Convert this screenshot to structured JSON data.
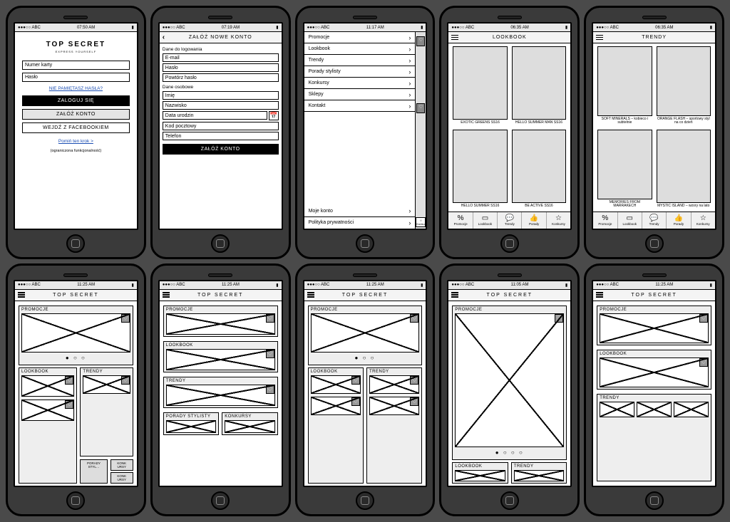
{
  "status": {
    "carrier": "●●●○○ ABC",
    "time1": "07:50 AM",
    "time2": "07:19 AM",
    "time3": "11:17 AM",
    "time4": "06:35 AM",
    "time5": "11:25 AM",
    "time6": "11:05 AM"
  },
  "login": {
    "logo": "TOP SECRET",
    "tagline": "EXPRESS YOURSELF",
    "card_placeholder": "Numer karty",
    "pass_placeholder": "Hasło",
    "forgot": "NIE PAMIĘTASZ HASŁA?",
    "btn_login": "ZALOGUJ SIĘ",
    "btn_register": "ZAŁÓŻ KONTO",
    "btn_fb": "WEJDŹ Z FACEBOOKIEM",
    "skip": "Pomiń ten krok >",
    "note": "(ograniczona funkcjonalność)"
  },
  "register": {
    "title": "ZAŁÓŻ NOWE KONTO",
    "sec1": "Dane do logowania",
    "email": "E-mail",
    "pass": "Hasło",
    "pass2": "Powtórz hasło",
    "sec2": "Dane osobowe",
    "fname": "Imię",
    "lname": "Nazwisko",
    "dob": "Data urodzin",
    "zip": "Kod pocztowy",
    "phone": "Telefon",
    "btn": "ZAŁÓŻ KONTO"
  },
  "menu": {
    "items": [
      "Promocje",
      "Lookbook",
      "Trendy",
      "Porady stylisty",
      "Konkursy",
      "Sklepy",
      "Kontakt"
    ],
    "account": "Moje konto",
    "privacy": "Polityka prywatności",
    "star_label": "Konkursy"
  },
  "lookbook": {
    "title": "LOOKBOOK",
    "cards": [
      {
        "t": "EXOTIC GREENS SS16"
      },
      {
        "t": "HELLO SUMMER MAN SS16"
      },
      {
        "t": "HELLO SUMMER SS16"
      },
      {
        "t": "BE ACTIVE SS16"
      }
    ]
  },
  "trendy": {
    "title": "TRENDY",
    "cards": [
      {
        "t": "SOFT MINERALS – kobieco i subtelnie"
      },
      {
        "t": "ORANGE FLASH – sportowy styl na co dzień"
      },
      {
        "t": "MEMORIES FROM MARRAKECH"
      },
      {
        "t": "MYSTIC ISLAND – wzory na lato"
      }
    ]
  },
  "tabbar": {
    "items": [
      {
        "ico": "%",
        "label": "Promocje"
      },
      {
        "ico": "▭",
        "label": "Lookbook"
      },
      {
        "ico": "💬",
        "label": "Trendy"
      },
      {
        "ico": "👍",
        "label": "Porady"
      },
      {
        "ico": "☆",
        "label": "Konkursy"
      }
    ]
  },
  "home": {
    "brand": "TOP SECRET",
    "promo": "PROMOCJE",
    "lookbook": "LOOKBOOK",
    "trendy": "TRENDY",
    "porady": "PORADY STYLISTY",
    "konkursy": "KONKURSY",
    "porady_short": "PORADY STYL…",
    "konk_short1": "KONK URSY",
    "konk_short2": "KONK URSY",
    "dots3": "● ○ ○",
    "dots4": "● ○ ○ ○"
  }
}
